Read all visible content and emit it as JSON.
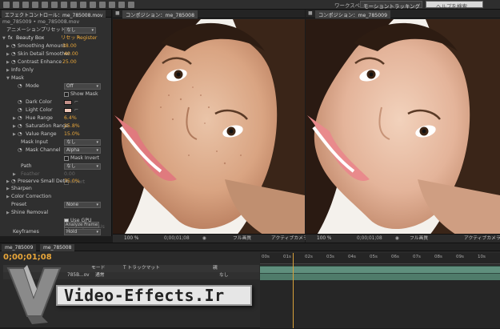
{
  "toolbar": {
    "workspace_label": "ワークスペース：",
    "workspace_value": "モーショントラッキング",
    "help_placeholder": "ヘルプを検索"
  },
  "effect_controls": {
    "tab_title": "エフェクトコントロール：me_785008.mov",
    "breadcrumb": "me_785009 • me_785008.mov",
    "anchor_label": "アニメーションプリセット：",
    "anchor_value": "なし",
    "effect_name": "Beauty Box",
    "reset_label": "リセット",
    "register_label": "Register",
    "params": [
      {
        "label": "Smoothing Amount",
        "value": "38.00"
      },
      {
        "label": "Skin Detail Smoother",
        "value": "40.00"
      },
      {
        "label": "Contrast Enhance",
        "value": "25.00"
      }
    ],
    "info_only": "Info Only",
    "mask_group": "Mask",
    "mode_label": "Mode",
    "mode_value": "Off",
    "show_mask": "Show Mask",
    "dark_color": "Dark Color",
    "light_color": "Light Color",
    "hue_range": "Hue Range",
    "hue_value": "6.4%",
    "sat_range": "Saturation Range",
    "sat_value": "25.8%",
    "value_range": "Value Range",
    "value_value": "15.0%",
    "mask_input": "Mask Input",
    "mask_input_value": "なし",
    "mask_channel": "Mask Channel",
    "mask_channel_value": "Alpha",
    "mask_invert": "Mask Invert",
    "path": "Path",
    "path_value": "なし",
    "feather": "Feather",
    "feather_value": "0.00",
    "invert": "Invert",
    "preserve": "Preserve Small Deta",
    "preserve_value": "75.0%",
    "sharpen": "Sharpen",
    "color_correction": "Color Correction",
    "preset": "Preset",
    "preset_value": "None",
    "shine": "Shine Removal",
    "use_gpu": "Use GPU",
    "multiple_gpus": "Multiple GPUs",
    "analyze": "Analyze Frame",
    "keyframes": "Keyframes",
    "keyframes_value": "Hold"
  },
  "viewer_left": {
    "tab": "コンポジション：me_785008",
    "zoom": "100 %",
    "timecode": "0;00;01;08",
    "quality": "フル画質",
    "camera": "アクティブカメラ"
  },
  "viewer_right": {
    "tab": "コンポジション：me_785009",
    "zoom": "100 %",
    "timecode": "0;00;01;08",
    "quality": "フル画質",
    "camera": "アクティブカメラ"
  },
  "timeline": {
    "tabs": [
      "me_785009",
      "me_785008"
    ],
    "timecode": "0;00;01;08",
    "col_mode": "モード",
    "col_track": "T トラックマット",
    "col_parent": "親",
    "layer_name": "785B...ov",
    "layer_mode": "通常",
    "layer_parent": "なし",
    "ticks": [
      "00s",
      "01s",
      "02s",
      "03s",
      "04s",
      "05s",
      "06s",
      "07s",
      "08s",
      "09s",
      "10s"
    ]
  },
  "watermark": {
    "text": "Video-Effects.Ir"
  }
}
